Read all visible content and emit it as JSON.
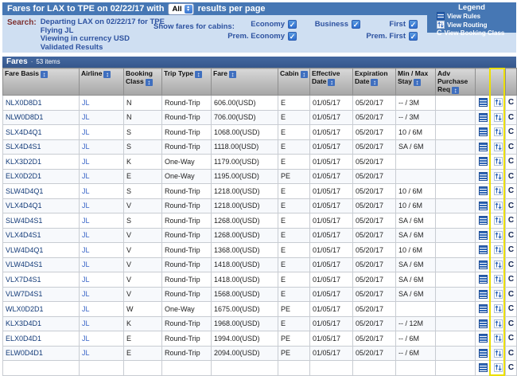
{
  "colors": {
    "header_blue": "#4677b4",
    "panel_blue": "#cfdff2",
    "bar_blue": "#3c5f96",
    "highlight_yellow": "#ecdf00",
    "link_blue": "#3a66c8"
  },
  "header": {
    "title_prefix": "Fares for LAX to TPE on 02/22/17 with",
    "per_page": "All",
    "title_suffix": "results per page",
    "legend": {
      "title": "Legend",
      "items": [
        {
          "icon": "view-rules-icon",
          "label": "View Rules"
        },
        {
          "icon": "view-routing-icon",
          "label": "View Routing"
        },
        {
          "icon": "view-booking-class-icon",
          "label": "View Booking Class"
        }
      ]
    }
  },
  "search": {
    "label": "Search:",
    "lines": [
      "Departing LAX on 02/22/17 for TPE",
      "Flying JL",
      "Viewing in currency USD",
      "Validated Results"
    ],
    "cabins_label": "Show fares for cabins:",
    "cabins": [
      {
        "label": "Economy",
        "checked": true
      },
      {
        "label": "Business",
        "checked": true
      },
      {
        "label": "First",
        "checked": true
      },
      {
        "label": "Prem. Economy",
        "checked": true
      },
      {
        "label": "Prem. First",
        "checked": true
      }
    ]
  },
  "results_bar": {
    "title": "Fares",
    "bullet": "·",
    "count": "53 items"
  },
  "icons": {
    "booking_class_glyph": "C"
  },
  "table": {
    "columns": [
      "Fare Basis",
      "Airline",
      "Booking Class",
      "Trip Type",
      "Fare",
      "Cabin",
      "Effective Date",
      "Expiration Date",
      "Min / Max Stay",
      "Adv Purchase Req"
    ],
    "partial_next_row": true,
    "rows": [
      {
        "fare_basis": "NLX0D8D1",
        "airline": "JL",
        "booking_class": "N",
        "trip_type": "Round-Trip",
        "fare": "606.00(USD)",
        "cabin": "E",
        "effective": "01/05/17",
        "expiration": "05/20/17",
        "stay": "-- / 3M",
        "adv": ""
      },
      {
        "fare_basis": "NLW0D8D1",
        "airline": "JL",
        "booking_class": "N",
        "trip_type": "Round-Trip",
        "fare": "706.00(USD)",
        "cabin": "E",
        "effective": "01/05/17",
        "expiration": "05/20/17",
        "stay": "-- / 3M",
        "adv": ""
      },
      {
        "fare_basis": "SLX4D4Q1",
        "airline": "JL",
        "booking_class": "S",
        "trip_type": "Round-Trip",
        "fare": "1068.00(USD)",
        "cabin": "E",
        "effective": "01/05/17",
        "expiration": "05/20/17",
        "stay": "10 / 6M",
        "adv": ""
      },
      {
        "fare_basis": "SLX4D4S1",
        "airline": "JL",
        "booking_class": "S",
        "trip_type": "Round-Trip",
        "fare": "1118.00(USD)",
        "cabin": "E",
        "effective": "01/05/17",
        "expiration": "05/20/17",
        "stay": "SA / 6M",
        "adv": ""
      },
      {
        "fare_basis": "KLX3D2D1",
        "airline": "JL",
        "booking_class": "K",
        "trip_type": "One-Way",
        "fare": "1179.00(USD)",
        "cabin": "E",
        "effective": "01/05/17",
        "expiration": "05/20/17",
        "stay": "",
        "adv": ""
      },
      {
        "fare_basis": "ELX0D2D1",
        "airline": "JL",
        "booking_class": "E",
        "trip_type": "One-Way",
        "fare": "1195.00(USD)",
        "cabin": "PE",
        "effective": "01/05/17",
        "expiration": "05/20/17",
        "stay": "",
        "adv": ""
      },
      {
        "fare_basis": "SLW4D4Q1",
        "airline": "JL",
        "booking_class": "S",
        "trip_type": "Round-Trip",
        "fare": "1218.00(USD)",
        "cabin": "E",
        "effective": "01/05/17",
        "expiration": "05/20/17",
        "stay": "10 / 6M",
        "adv": ""
      },
      {
        "fare_basis": "VLX4D4Q1",
        "airline": "JL",
        "booking_class": "V",
        "trip_type": "Round-Trip",
        "fare": "1218.00(USD)",
        "cabin": "E",
        "effective": "01/05/17",
        "expiration": "05/20/17",
        "stay": "10 / 6M",
        "adv": ""
      },
      {
        "fare_basis": "SLW4D4S1",
        "airline": "JL",
        "booking_class": "S",
        "trip_type": "Round-Trip",
        "fare": "1268.00(USD)",
        "cabin": "E",
        "effective": "01/05/17",
        "expiration": "05/20/17",
        "stay": "SA / 6M",
        "adv": ""
      },
      {
        "fare_basis": "VLX4D4S1",
        "airline": "JL",
        "booking_class": "V",
        "trip_type": "Round-Trip",
        "fare": "1268.00(USD)",
        "cabin": "E",
        "effective": "01/05/17",
        "expiration": "05/20/17",
        "stay": "SA / 6M",
        "adv": ""
      },
      {
        "fare_basis": "VLW4D4Q1",
        "airline": "JL",
        "booking_class": "V",
        "trip_type": "Round-Trip",
        "fare": "1368.00(USD)",
        "cabin": "E",
        "effective": "01/05/17",
        "expiration": "05/20/17",
        "stay": "10 / 6M",
        "adv": ""
      },
      {
        "fare_basis": "VLW4D4S1",
        "airline": "JL",
        "booking_class": "V",
        "trip_type": "Round-Trip",
        "fare": "1418.00(USD)",
        "cabin": "E",
        "effective": "01/05/17",
        "expiration": "05/20/17",
        "stay": "SA / 6M",
        "adv": ""
      },
      {
        "fare_basis": "VLX7D4S1",
        "airline": "JL",
        "booking_class": "V",
        "trip_type": "Round-Trip",
        "fare": "1418.00(USD)",
        "cabin": "E",
        "effective": "01/05/17",
        "expiration": "05/20/17",
        "stay": "SA / 6M",
        "adv": ""
      },
      {
        "fare_basis": "VLW7D4S1",
        "airline": "JL",
        "booking_class": "V",
        "trip_type": "Round-Trip",
        "fare": "1568.00(USD)",
        "cabin": "E",
        "effective": "01/05/17",
        "expiration": "05/20/17",
        "stay": "SA / 6M",
        "adv": ""
      },
      {
        "fare_basis": "WLX0D2D1",
        "airline": "JL",
        "booking_class": "W",
        "trip_type": "One-Way",
        "fare": "1675.00(USD)",
        "cabin": "PE",
        "effective": "01/05/17",
        "expiration": "05/20/17",
        "stay": "",
        "adv": ""
      },
      {
        "fare_basis": "KLX3D4D1",
        "airline": "JL",
        "booking_class": "K",
        "trip_type": "Round-Trip",
        "fare": "1968.00(USD)",
        "cabin": "E",
        "effective": "01/05/17",
        "expiration": "05/20/17",
        "stay": "-- / 12M",
        "adv": ""
      },
      {
        "fare_basis": "ELX0D4D1",
        "airline": "JL",
        "booking_class": "E",
        "trip_type": "Round-Trip",
        "fare": "1994.00(USD)",
        "cabin": "PE",
        "effective": "01/05/17",
        "expiration": "05/20/17",
        "stay": "-- / 6M",
        "adv": ""
      },
      {
        "fare_basis": "ELW0D4D1",
        "airline": "JL",
        "booking_class": "E",
        "trip_type": "Round-Trip",
        "fare": "2094.00(USD)",
        "cabin": "PE",
        "effective": "01/05/17",
        "expiration": "05/20/17",
        "stay": "-- / 6M",
        "adv": ""
      }
    ]
  }
}
